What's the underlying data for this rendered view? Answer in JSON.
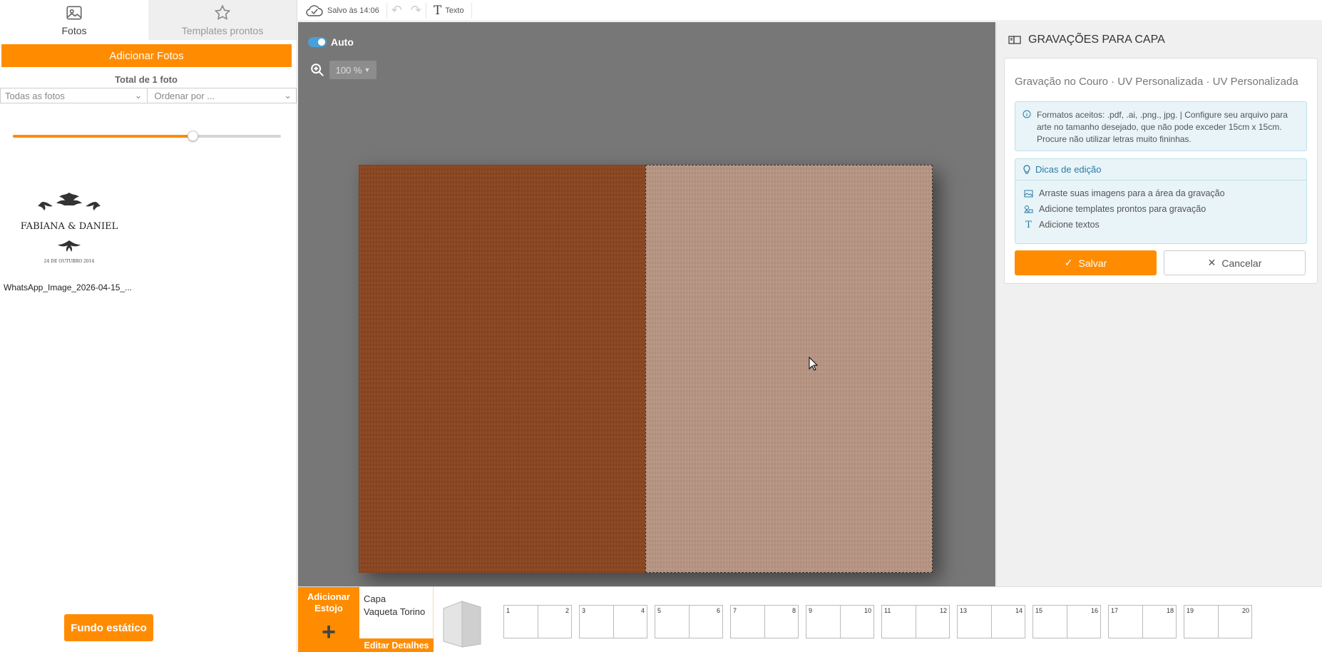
{
  "sidebar": {
    "tabs": [
      {
        "label": "Fotos",
        "icon": "image-icon",
        "active": true
      },
      {
        "label": "Templates prontos",
        "icon": "star-icon",
        "active": false
      }
    ],
    "add_photos_label": "Adicionar Fotos",
    "total_label": "Total de 1 foto",
    "filter_all": "Todas as fotos",
    "filter_order": "Ordenar por ...",
    "slider_value_percent": 67,
    "photo": {
      "filename": "WhatsApp_Image_2026-04-15_...",
      "logo_text": "FABIANA & DANIEL",
      "logo_date": "24 DE OUTUBRO 2014"
    },
    "fundo_label": "Fundo estático"
  },
  "toolbar": {
    "saved_label": "Salvo às 14:06",
    "text_label": "Texto"
  },
  "canvas": {
    "auto_label": "Auto",
    "auto_on": true,
    "zoom_label": "100 %",
    "colors": {
      "left_cover": "#8b4520",
      "right_cover": "#b89482",
      "background": "#777777"
    }
  },
  "right_panel": {
    "header": "GRAVAÇÕES PARA CAPA",
    "title": "Gravação no Couro · UV Personalizada · UV Personalizada",
    "info_text": "Formatos aceitos: .pdf, .ai, .png., jpg. | Configure seu arquivo para arte no tamanho desejado, que não pode exceder 15cm x 15cm. Procure não utilizar letras muito fininhas.",
    "tips_header": "Dicas de edição",
    "tips": [
      {
        "icon": "image-icon",
        "text": "Arraste suas imagens para a área da gravação"
      },
      {
        "icon": "templates-icon",
        "text": "Adicione templates prontos para gravação"
      },
      {
        "icon": "text-icon",
        "text": "Adicione textos"
      }
    ],
    "save_label": "Salvar",
    "cancel_label": "Cancelar"
  },
  "bottom": {
    "add_estojo_label": "Adicionar Estojo",
    "plus": "+",
    "capa_label": "Capa",
    "capa_material": "Vaqueta Torino",
    "edit_label": "Editar Detalhes",
    "pages": [
      [
        "1",
        "2"
      ],
      [
        "3",
        "4"
      ],
      [
        "5",
        "6"
      ],
      [
        "7",
        "8"
      ],
      [
        "9",
        "10"
      ],
      [
        "11",
        "12"
      ],
      [
        "13",
        "14"
      ],
      [
        "15",
        "16"
      ],
      [
        "17",
        "18"
      ],
      [
        "19",
        "20"
      ]
    ]
  },
  "colors": {
    "accent": "#ff8c00",
    "info_blue": "#2a7ba6"
  }
}
